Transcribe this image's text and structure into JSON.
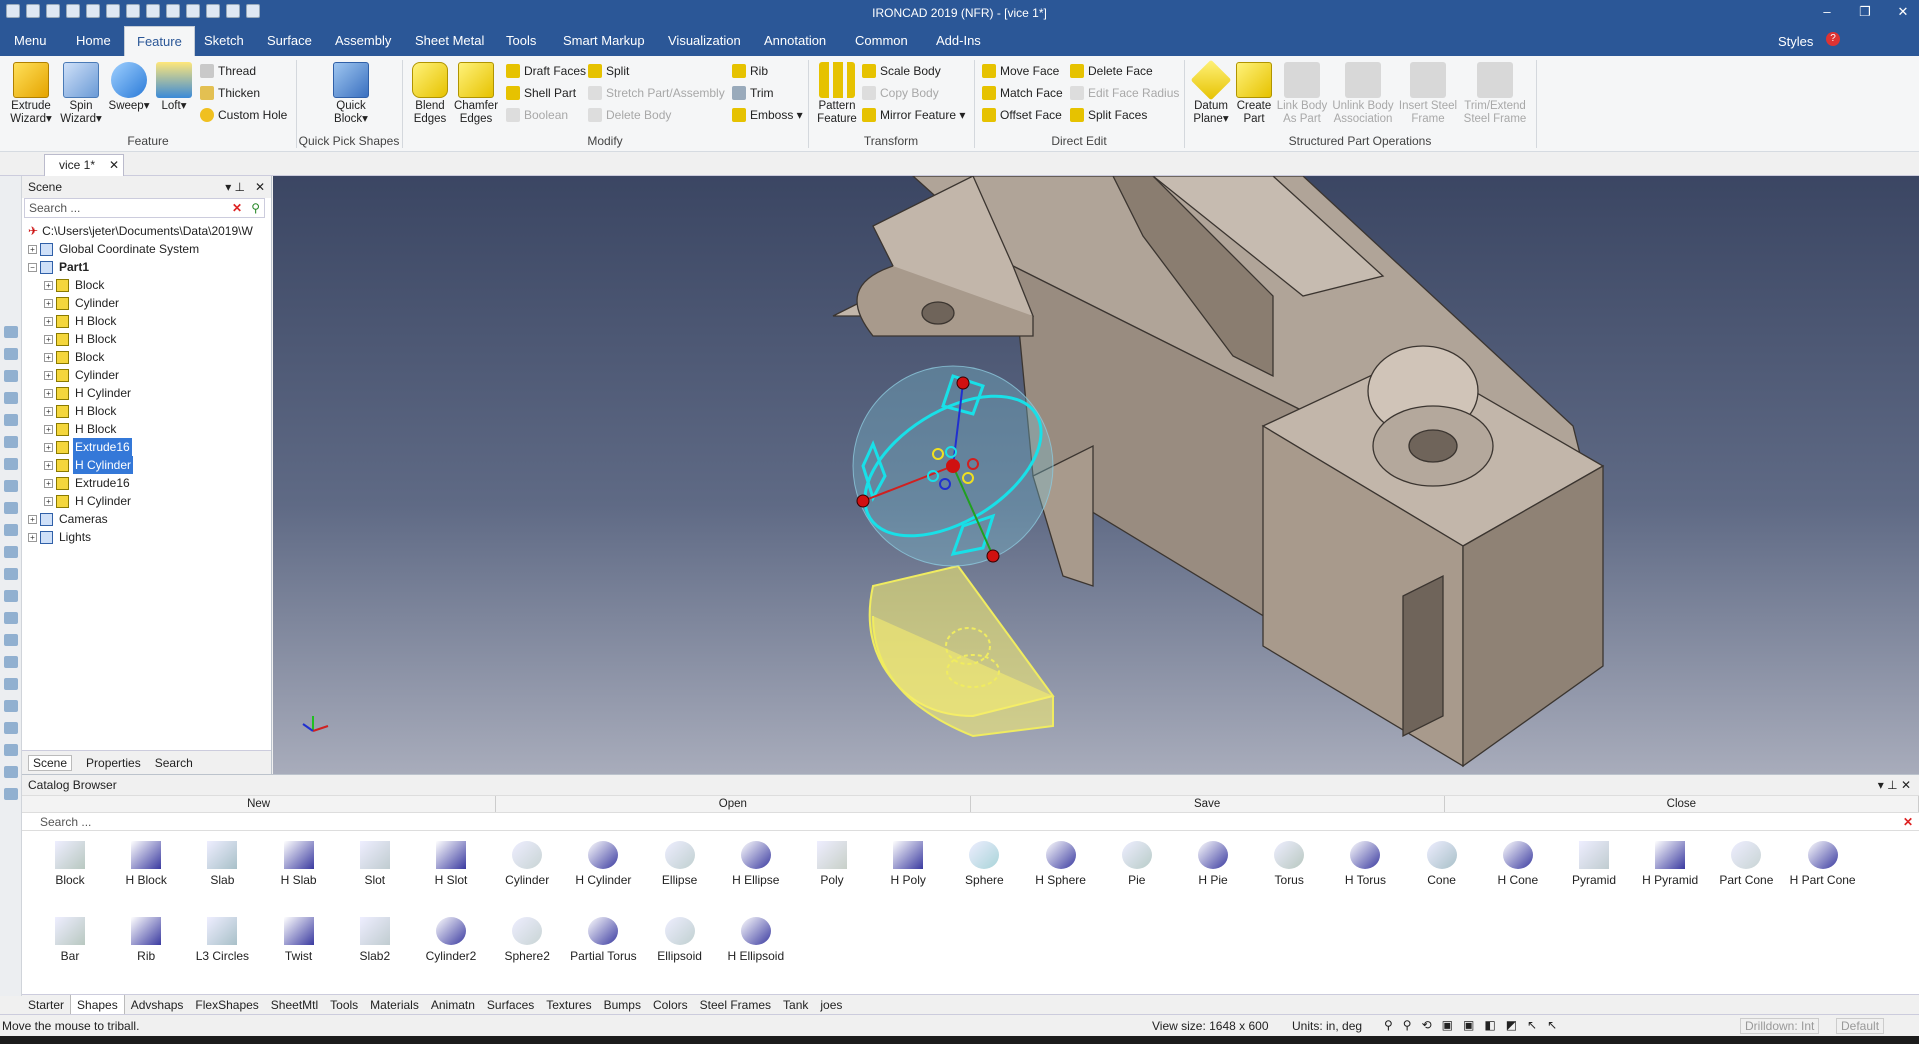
{
  "window": {
    "title": "IRONCAD 2019 (NFR) - [vice 1*]",
    "controls": [
      "–",
      "❐",
      "✕"
    ],
    "quick_access_icons": [
      "new-icon",
      "open-icon",
      "save-icon",
      "print-icon",
      "undo-icon",
      "redo-icon",
      "render-icon",
      "layout-icon"
    ]
  },
  "menu": {
    "tabs": [
      "Menu",
      "Home",
      "Feature",
      "Sketch",
      "Surface",
      "Assembly",
      "Sheet Metal",
      "Tools",
      "Smart Markup",
      "Visualization",
      "Annotation",
      "Common",
      "Add-Ins"
    ],
    "active": "Feature",
    "styles_label": "Styles"
  },
  "ribbon": {
    "groups": {
      "feature": "Feature",
      "quick_pick": "Quick Pick Shapes",
      "modify": "Modify",
      "transform": "Transform",
      "direct_edit": "Direct Edit",
      "structured": "Structured Part Operations"
    },
    "feature_big": [
      "Extrude Wizard▾",
      "Spin Wizard▾",
      "Sweep▾",
      "Loft▾"
    ],
    "feature_small": [
      "Thread",
      "Thicken",
      "Custom Hole"
    ],
    "quick_block": "Quick Block▾",
    "blend_edges": "Blend Edges",
    "chamfer_edges": "Chamfer Edges",
    "modify_small": [
      "Draft Faces",
      "Shell Part",
      "Boolean",
      "Split",
      "Stretch Part/Assembly",
      "Delete Body",
      "Rib",
      "Trim",
      "Emboss ▾"
    ],
    "pattern_feature": "Pattern Feature",
    "transform_small": [
      "Scale Body",
      "Copy Body",
      "Mirror Feature ▾"
    ],
    "direct_edit_small": [
      "Move Face",
      "Match Face",
      "Offset Face",
      "Delete Face",
      "Edit Face Radius",
      "Split Faces"
    ],
    "structured_big": [
      "Datum Plane▾",
      "Create Part",
      "Link Body As Part",
      "Unlink Body Association",
      "Insert Steel Frame",
      "Trim/Extend Steel Frame"
    ]
  },
  "doc_tab": {
    "label": "vice 1*"
  },
  "scene": {
    "title": "Scene",
    "search_placeholder": "Search ...",
    "root": "C:\\Users\\jeter\\Documents\\Data\\2019\\W",
    "items": [
      {
        "label": "Global Coordinate System",
        "level": 1,
        "sel": false
      },
      {
        "label": "Part1",
        "level": 1,
        "sel": false,
        "bold": true
      },
      {
        "label": "Block",
        "level": 2,
        "sel": false
      },
      {
        "label": "Cylinder",
        "level": 2,
        "sel": false
      },
      {
        "label": "H Block",
        "level": 2,
        "sel": false
      },
      {
        "label": "H Block",
        "level": 2,
        "sel": false
      },
      {
        "label": "Block",
        "level": 2,
        "sel": false
      },
      {
        "label": "Cylinder",
        "level": 2,
        "sel": false
      },
      {
        "label": "H Cylinder",
        "level": 2,
        "sel": false
      },
      {
        "label": "H Block",
        "level": 2,
        "sel": false
      },
      {
        "label": "H Block",
        "level": 2,
        "sel": false
      },
      {
        "label": "Extrude16",
        "level": 2,
        "sel": true
      },
      {
        "label": "H Cylinder",
        "level": 2,
        "sel": true
      },
      {
        "label": "Extrude16",
        "level": 2,
        "sel": false
      },
      {
        "label": "H Cylinder",
        "level": 2,
        "sel": false
      },
      {
        "label": "Cameras",
        "level": 1,
        "sel": false
      },
      {
        "label": "Lights",
        "level": 1,
        "sel": false
      }
    ],
    "tabs": [
      "Scene",
      "Properties",
      "Search"
    ]
  },
  "catalog": {
    "title": "Catalog Browser",
    "buttons": [
      "New",
      "Open",
      "Save",
      "Close"
    ],
    "search_placeholder": "Search ...",
    "shapes_row1": [
      "Block",
      "H Block",
      "Slab",
      "H Slab",
      "Slot",
      "H Slot",
      "Cylinder",
      "H Cylinder",
      "Ellipse",
      "H Ellipse",
      "Poly",
      "H Poly",
      "Sphere",
      "H Sphere",
      "Pie",
      "H Pie",
      "Torus",
      "H Torus",
      "Cone",
      "H Cone",
      "Pyramid",
      "H Pyramid",
      "Part Cone",
      "H Part Cone"
    ],
    "shapes_row2": [
      "Bar",
      "Rib",
      "L3 Circles",
      "Twist",
      "Slab2",
      "Cylinder2",
      "Sphere2",
      "Partial Torus",
      "Ellipsoid",
      "H Ellipsoid"
    ],
    "tabs": [
      "Starter",
      "Shapes",
      "Advshaps",
      "FlexShapes",
      "SheetMtl",
      "Tools",
      "Materials",
      "Animatn",
      "Surfaces",
      "Textures",
      "Bumps",
      "Colors",
      "Steel Frames",
      "Tank",
      "joes"
    ],
    "active_tab": "Shapes"
  },
  "status": {
    "message": "Move the mouse to triball.",
    "view_size": "View size: 1648 x 600",
    "units": "Units: in, deg",
    "drilldown": "Drilldown: Int",
    "default": "Default"
  },
  "colors": {
    "accent": "#2b5797",
    "selection": "#3478d8",
    "model": "#b8aca0",
    "highlight_yellow": "#f0ec60",
    "triball_cyan": "#18e0e8"
  }
}
